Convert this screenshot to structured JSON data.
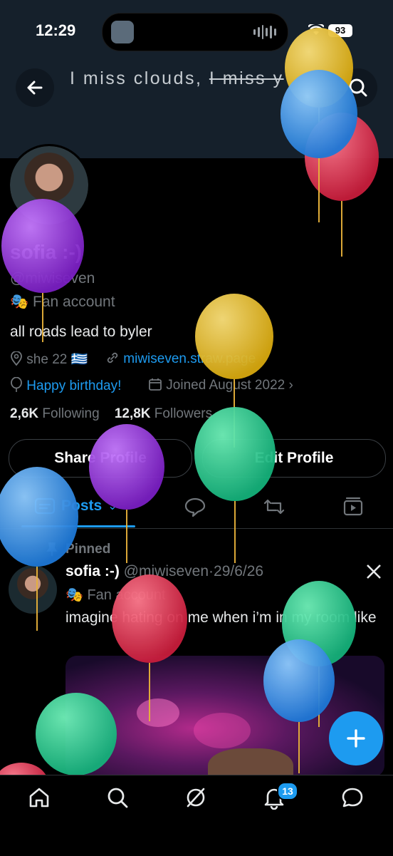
{
  "status": {
    "time": "12:29",
    "battery": "93"
  },
  "banner": {
    "text_plain": "I miss clouds, ",
    "text_struck": "I miss y"
  },
  "profile": {
    "name": "sofia :-)",
    "handle": "@miwiseven",
    "category": "Fan account",
    "bio": "all roads lead to byler",
    "location": "she 22 🇬🇷",
    "website": "miwiseven.straw.page",
    "birthday": "Happy birthday!",
    "joined": "Joined August 2022",
    "following_count": "2,6K",
    "following_label": "Following",
    "followers_count": "12,8K",
    "followers_label": "Followers"
  },
  "buttons": {
    "share": "Share Profile",
    "edit": "Edit Profile"
  },
  "tabs": {
    "posts": "Posts"
  },
  "post": {
    "pinned_label": "Pinned",
    "author": "sofia :-)",
    "handle": "@miwiseven",
    "date": "29/6/26",
    "category": "Fan account",
    "text": "imagine hating on me when i’m in my room like"
  },
  "nav": {
    "notifications_badge": "13"
  },
  "colors": {
    "accent": "#1d9bf0",
    "background": "#000000",
    "banner": "#15202b"
  }
}
